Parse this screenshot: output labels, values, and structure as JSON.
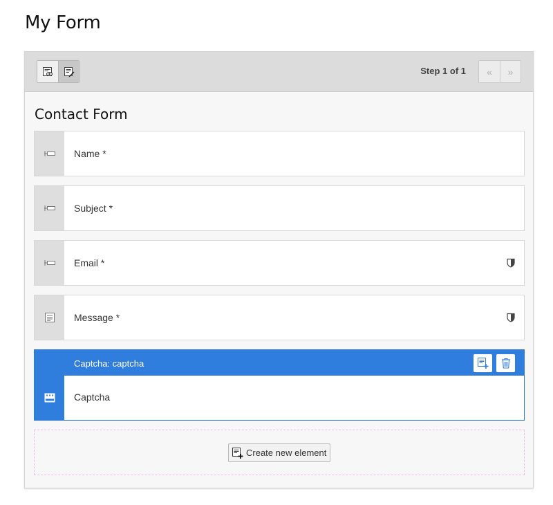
{
  "page": {
    "title": "My Form"
  },
  "toolbar": {
    "view_modes": [
      {
        "name": "preview",
        "icon": "preview-icon",
        "active": false
      },
      {
        "name": "abstract",
        "icon": "edit-view-icon",
        "active": true
      }
    ],
    "step_label": "Step 1 of 1",
    "prev_glyph": "«",
    "next_glyph": "»"
  },
  "form": {
    "title": "Contact Form",
    "elements": [
      {
        "label": "Name *",
        "icon": "text-field-icon",
        "validator": false
      },
      {
        "label": "Subject *",
        "icon": "text-field-icon",
        "validator": false
      },
      {
        "label": "Email *",
        "icon": "text-field-icon",
        "validator": true
      },
      {
        "label": "Message *",
        "icon": "textarea-icon",
        "validator": true
      }
    ],
    "selected": {
      "header": "Captcha: captcha",
      "label": "Captcha",
      "icon": "captcha-icon"
    },
    "create_label": "Create new element"
  },
  "colors": {
    "accent": "#2f7ddd",
    "toolbar_bg": "#dcdcdc",
    "panel_bg": "#f7f7f7"
  }
}
